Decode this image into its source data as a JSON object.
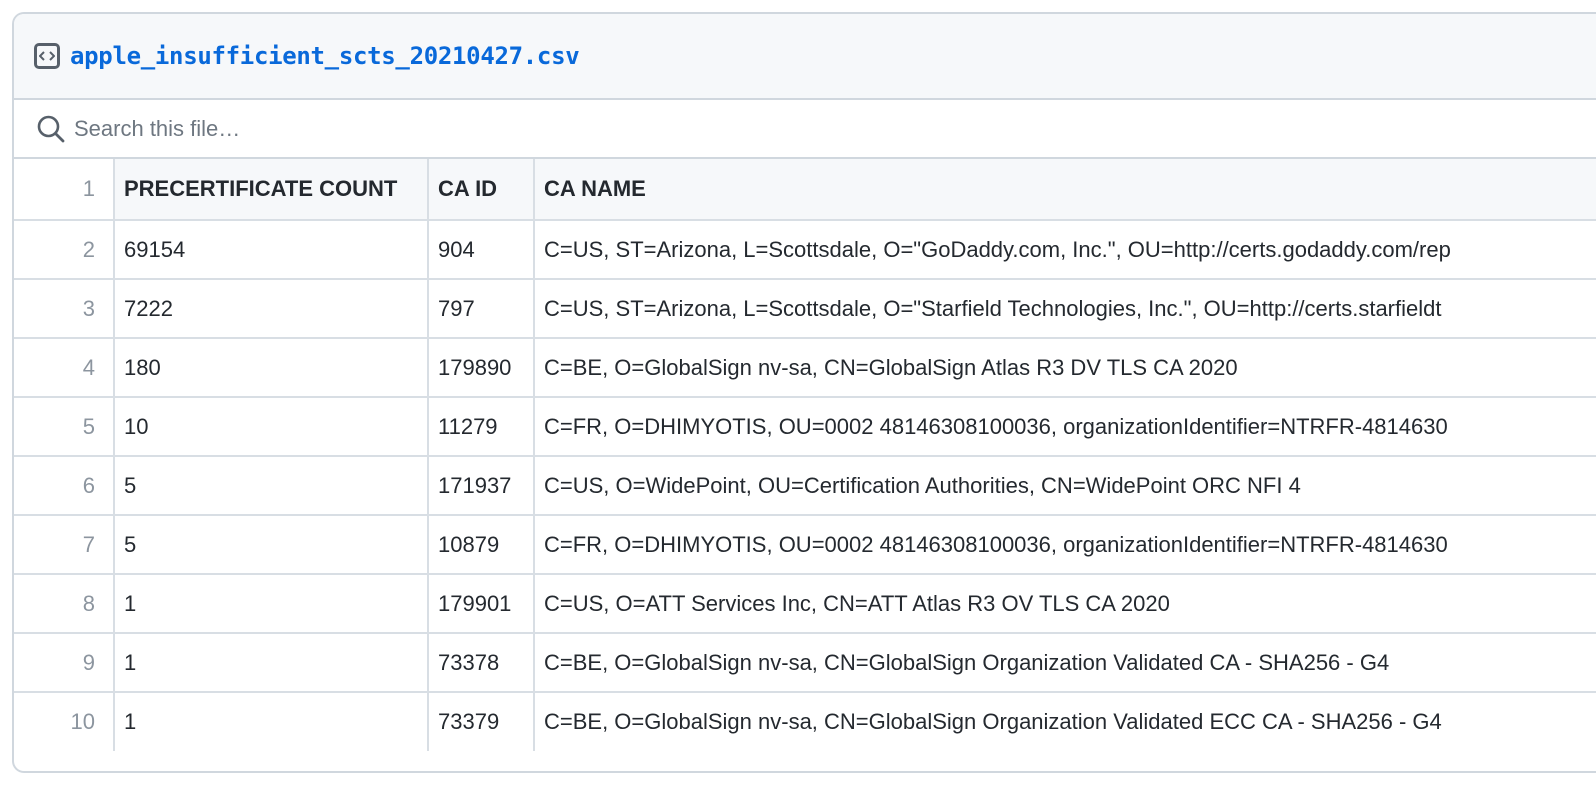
{
  "file": {
    "name": "apple_insufficient_scts_20210427.csv"
  },
  "search": {
    "placeholder": "Search this file…"
  },
  "table": {
    "header_line": "1",
    "columns": [
      "PRECERTIFICATE COUNT",
      "CA ID",
      "CA NAME"
    ],
    "rows": [
      {
        "line": "2",
        "count": "69154",
        "ca_id": "904",
        "ca_name": "C=US, ST=Arizona, L=Scottsdale, O=\"GoDaddy.com, Inc.\", OU=http://certs.godaddy.com/rep"
      },
      {
        "line": "3",
        "count": "7222",
        "ca_id": "797",
        "ca_name": "C=US, ST=Arizona, L=Scottsdale, O=\"Starfield Technologies, Inc.\", OU=http://certs.starfieldt"
      },
      {
        "line": "4",
        "count": "180",
        "ca_id": "179890",
        "ca_name": "C=BE, O=GlobalSign nv-sa, CN=GlobalSign Atlas R3 DV TLS CA 2020"
      },
      {
        "line": "5",
        "count": "10",
        "ca_id": "11279",
        "ca_name": "C=FR, O=DHIMYOTIS, OU=0002 48146308100036, organizationIdentifier=NTRFR-4814630"
      },
      {
        "line": "6",
        "count": "5",
        "ca_id": "171937",
        "ca_name": "C=US, O=WidePoint, OU=Certification Authorities, CN=WidePoint ORC NFI 4"
      },
      {
        "line": "7",
        "count": "5",
        "ca_id": "10879",
        "ca_name": "C=FR, O=DHIMYOTIS, OU=0002 48146308100036, organizationIdentifier=NTRFR-4814630"
      },
      {
        "line": "8",
        "count": "1",
        "ca_id": "179901",
        "ca_name": "C=US, O=ATT Services Inc, CN=ATT Atlas R3 OV TLS CA 2020"
      },
      {
        "line": "9",
        "count": "1",
        "ca_id": "73378",
        "ca_name": "C=BE, O=GlobalSign nv-sa, CN=GlobalSign Organization Validated CA - SHA256 - G4"
      },
      {
        "line": "10",
        "count": "1",
        "ca_id": "73379",
        "ca_name": "C=BE, O=GlobalSign nv-sa, CN=GlobalSign Organization Validated ECC CA - SHA256 - G4"
      }
    ]
  },
  "icons": {
    "file_icon": "file-code-icon",
    "search_icon": "search-icon"
  },
  "colors": {
    "link": "#0969da",
    "border": "#d0d7de",
    "header_bg": "#f6f8fa",
    "line_number": "#8c959f"
  }
}
